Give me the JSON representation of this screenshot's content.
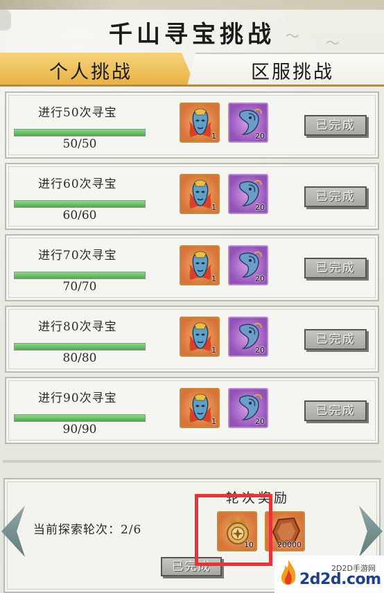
{
  "header": {
    "title": "千山寻宝挑战"
  },
  "tabs": [
    {
      "label": "个人挑战",
      "active": true
    },
    {
      "label": "区服挑战",
      "active": false
    }
  ],
  "challenges": [
    {
      "title": "进行50次寻宝",
      "progress_text": "50/50",
      "progress": 1.0,
      "rewards": [
        {
          "icon": "blue-mask-on-fire-icon",
          "count": "1"
        },
        {
          "icon": "blue-spirit-icon",
          "count": "20"
        }
      ],
      "button_label": "已完成"
    },
    {
      "title": "进行60次寻宝",
      "progress_text": "60/60",
      "progress": 1.0,
      "rewards": [
        {
          "icon": "blue-mask-on-fire-icon",
          "count": "1"
        },
        {
          "icon": "blue-spirit-icon",
          "count": "20"
        }
      ],
      "button_label": "已完成"
    },
    {
      "title": "进行70次寻宝",
      "progress_text": "70/70",
      "progress": 1.0,
      "rewards": [
        {
          "icon": "blue-mask-on-fire-icon",
          "count": "1"
        },
        {
          "icon": "blue-spirit-icon",
          "count": "20"
        }
      ],
      "button_label": "已完成"
    },
    {
      "title": "进行80次寻宝",
      "progress_text": "80/80",
      "progress": 1.0,
      "rewards": [
        {
          "icon": "blue-mask-on-fire-icon",
          "count": "1"
        },
        {
          "icon": "blue-spirit-icon",
          "count": "20"
        }
      ],
      "button_label": "已完成"
    },
    {
      "title": "进行90次寻宝",
      "progress_text": "90/90",
      "progress": 1.0,
      "rewards": [
        {
          "icon": "blue-mask-on-fire-icon",
          "count": "1"
        },
        {
          "icon": "blue-spirit-icon",
          "count": "20"
        }
      ],
      "button_label": "已完成"
    }
  ],
  "round_reward": {
    "title": "轮次奖励",
    "current_round": "当前探索轮次：2/6",
    "rewards": [
      {
        "icon": "golden-medal-icon",
        "count": "10"
      },
      {
        "icon": "copper-coin-icon",
        "count": "20000"
      }
    ],
    "button_label": "已完成"
  },
  "watermark": {
    "small_text": "2D2D手游网",
    "big_text": "2d2d.com"
  },
  "colors": {
    "tab_active": "#e9b246",
    "progress_fill": "#4daa4e",
    "highlight": "#e8333a",
    "watermark_blue": "#1d3f8f"
  }
}
